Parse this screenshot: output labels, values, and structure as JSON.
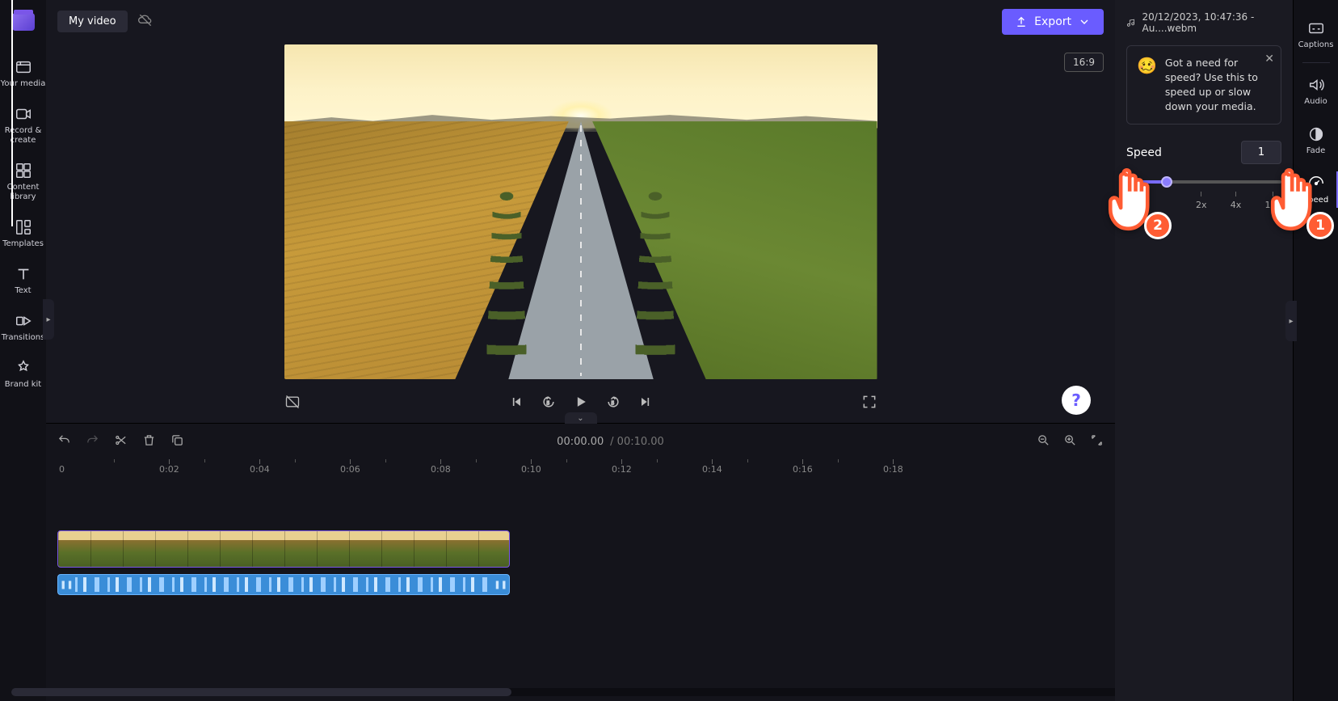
{
  "app": {
    "project_title": "My video"
  },
  "left_sidebar": {
    "items": [
      {
        "label": "Your media"
      },
      {
        "label": "Record & create"
      },
      {
        "label": "Content library"
      },
      {
        "label": "Templates"
      },
      {
        "label": "Text"
      },
      {
        "label": "Transitions"
      },
      {
        "label": "Brand kit"
      }
    ]
  },
  "header": {
    "export_label": "Export"
  },
  "preview": {
    "aspect_ratio": "16:9",
    "help_label": "?"
  },
  "timeline": {
    "current_time": "00:00.00",
    "duration": "00:10.00",
    "separator": "/",
    "ruler_start": "0",
    "ruler": [
      "0:02",
      "0:04",
      "0:06",
      "0:08",
      "0:10",
      "0:12",
      "0:14",
      "0:16",
      "0:18"
    ]
  },
  "right_panel": {
    "clip_name": "20/12/2023, 10:47:36 - Au....webm",
    "tip_emoji": "🥴",
    "tip_text": "Got a need for speed? Use this to speed up or slow down your media.",
    "speed_label": "Speed",
    "speed_value": "1",
    "slider_ticks": [
      "0.1x",
      "2x",
      "4x",
      "16x"
    ]
  },
  "far_right": {
    "items": [
      {
        "label": "Captions"
      },
      {
        "label": "Audio"
      },
      {
        "label": "Fade"
      },
      {
        "label": "Speed"
      }
    ]
  },
  "annotations": {
    "hand1_badge": "1",
    "hand2_badge": "2"
  }
}
